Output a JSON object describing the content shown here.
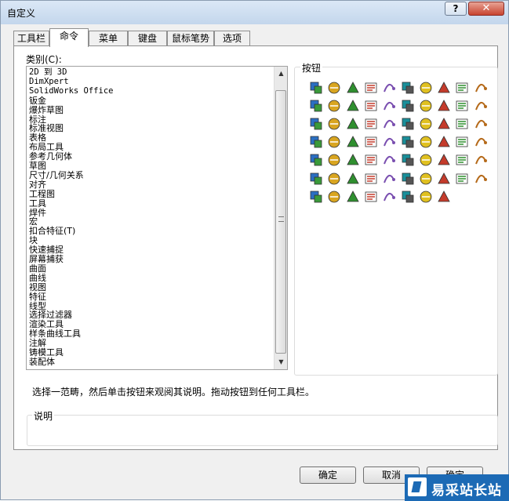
{
  "window": {
    "title": "自定义",
    "help_label": "?",
    "close_label": "✕"
  },
  "tabs": [
    {
      "label": "工具栏"
    },
    {
      "label": "命令"
    },
    {
      "label": "菜单"
    },
    {
      "label": "键盘"
    },
    {
      "label": "鼠标笔势"
    },
    {
      "label": "选项"
    }
  ],
  "active_tab": "命令",
  "category": {
    "label": "类别(C):",
    "items": [
      "2D 到 3D",
      "DimXpert",
      "SolidWorks Office",
      "钣金",
      "爆炸草图",
      "标注",
      "标准视图",
      "表格",
      "布局工具",
      "参考几何体",
      "草图",
      "尺寸/几何关系",
      "对齐",
      "工程图",
      "工具",
      "焊件",
      "宏",
      "扣合特征(T)",
      "块",
      "快速捕捉",
      "屏幕捕获",
      "曲面",
      "曲线",
      "视图",
      "特征",
      "线型",
      "选择过滤器",
      "渲染工具",
      "样条曲线工具",
      "注解",
      "铸模工具",
      "装配体"
    ]
  },
  "buttons_panel": {
    "label": "按钮",
    "icons": [
      "extrude-boss-icon",
      "flowchart-icon",
      "text-a-icon",
      "ruled-surface-icon",
      "picture-a-icon",
      "spiral-icon",
      "feature-tree-icon",
      "target-icon",
      "grid-table-icon",
      "step-icon",
      "globe-tool-icon",
      "bold-italic-icon",
      "plane-icon",
      "lines-icon",
      "color-bars-icon",
      "box-fill-icon",
      "center-mark-icon",
      "sparkle-icon",
      "pie-icon",
      "puzzle-icon",
      "select-arrow-icon",
      "camera-icon",
      "slash-percent-icon",
      "chamfer-cube-icon",
      "link-icon",
      "save-disk-icon",
      "copy-icon",
      "tag-icon",
      "table-icon",
      "camera-table-icon",
      "open-box-icon",
      "earth-icon",
      "chart-icon",
      "clipboard-icon",
      "open-folder-icon",
      "floppy-icon",
      "printer-icon",
      "list-icon",
      "pencil-edit-icon",
      "line-icon",
      "rect-tool-icon",
      "slot-icon",
      "dimension-circle-icon",
      "dashed-circle-icon",
      "ellipse-icon",
      "spline-icon",
      "fillet-corner-icon",
      "face-icon",
      "mirror-icon",
      "grid-snap-icon",
      "dot-grid-icon",
      "angle-icon",
      "ruler-icon",
      "yellow-box-icon",
      "yellow-cube-icon",
      "green-cube-icon",
      "dotted-bar-icon",
      "cylinder-icon",
      "folder-yellow-icon",
      "sheet-icon",
      "rotate-eye-icon",
      "bin-icon",
      "swap-arrows-icon",
      "wave-icon",
      "monitor-icon",
      "check-x-icon",
      "tree-icon",
      "stair-icon"
    ]
  },
  "hint": "选择一范畴，然后单击按钮来观阅其说明。拖动按钮到任何工具栏。",
  "description": {
    "label": "说明",
    "text": ""
  },
  "footer": {
    "ok_label": "确定",
    "cancel_label": "取消",
    "help_label": "确定"
  },
  "watermark": {
    "text": "易采站长站"
  },
  "colors": {
    "title_gradient_top": "#dbe8f6",
    "close_button": "#c8442f",
    "watermark_bg": "#1c6ab5"
  }
}
